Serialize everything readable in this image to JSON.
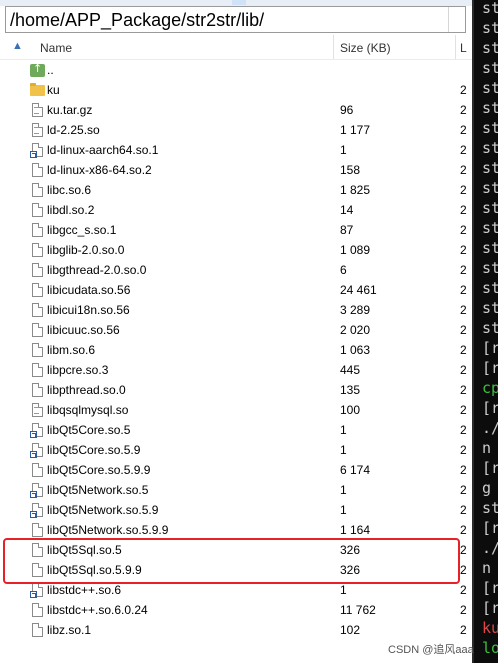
{
  "path_bar": {
    "value": "/home/APP_Package/str2str/lib/"
  },
  "columns": {
    "name": "Name",
    "size": "Size (KB)",
    "last": "L"
  },
  "files": [
    {
      "name": "..",
      "size": "",
      "extra": "",
      "icon": "parent-folder-icon"
    },
    {
      "name": "ku",
      "size": "",
      "extra": "2",
      "icon": "folder-icon"
    },
    {
      "name": "ku.tar.gz",
      "size": "96",
      "extra": "2",
      "icon": "archive-file-icon"
    },
    {
      "name": "ld-2.25.so",
      "size": "1 177",
      "extra": "2",
      "icon": "library-file-icon"
    },
    {
      "name": "ld-linux-aarch64.so.1",
      "size": "1",
      "extra": "2",
      "icon": "symlink-file-icon"
    },
    {
      "name": "ld-linux-x86-64.so.2",
      "size": "158",
      "extra": "2",
      "icon": "file-icon"
    },
    {
      "name": "libc.so.6",
      "size": "1 825",
      "extra": "2",
      "icon": "file-icon"
    },
    {
      "name": "libdl.so.2",
      "size": "14",
      "extra": "2",
      "icon": "file-icon"
    },
    {
      "name": "libgcc_s.so.1",
      "size": "87",
      "extra": "2",
      "icon": "file-icon"
    },
    {
      "name": "libglib-2.0.so.0",
      "size": "1 089",
      "extra": "2",
      "icon": "file-icon"
    },
    {
      "name": "libgthread-2.0.so.0",
      "size": "6",
      "extra": "2",
      "icon": "file-icon"
    },
    {
      "name": "libicudata.so.56",
      "size": "24 461",
      "extra": "2",
      "icon": "file-icon"
    },
    {
      "name": "libicui18n.so.56",
      "size": "3 289",
      "extra": "2",
      "icon": "file-icon"
    },
    {
      "name": "libicuuc.so.56",
      "size": "2 020",
      "extra": "2",
      "icon": "file-icon"
    },
    {
      "name": "libm.so.6",
      "size": "1 063",
      "extra": "2",
      "icon": "file-icon"
    },
    {
      "name": "libpcre.so.3",
      "size": "445",
      "extra": "2",
      "icon": "file-icon"
    },
    {
      "name": "libpthread.so.0",
      "size": "135",
      "extra": "2",
      "icon": "file-icon"
    },
    {
      "name": "libqsqlmysql.so",
      "size": "100",
      "extra": "2",
      "icon": "library-file-icon"
    },
    {
      "name": "libQt5Core.so.5",
      "size": "1",
      "extra": "2",
      "icon": "symlink-file-icon"
    },
    {
      "name": "libQt5Core.so.5.9",
      "size": "1",
      "extra": "2",
      "icon": "symlink-file-icon"
    },
    {
      "name": "libQt5Core.so.5.9.9",
      "size": "6 174",
      "extra": "2",
      "icon": "file-icon"
    },
    {
      "name": "libQt5Network.so.5",
      "size": "1",
      "extra": "2",
      "icon": "symlink-file-icon"
    },
    {
      "name": "libQt5Network.so.5.9",
      "size": "1",
      "extra": "2",
      "icon": "symlink-file-icon"
    },
    {
      "name": "libQt5Network.so.5.9.9",
      "size": "1 164",
      "extra": "2",
      "icon": "file-icon"
    },
    {
      "name": "libQt5Sql.so.5",
      "size": "326",
      "extra": "2",
      "icon": "file-icon"
    },
    {
      "name": "libQt5Sql.so.5.9.9",
      "size": "326",
      "extra": "2",
      "icon": "file-icon"
    },
    {
      "name": "libstdc++.so.6",
      "size": "1",
      "extra": "2",
      "icon": "symlink-file-icon"
    },
    {
      "name": "libstdc++.so.6.0.24",
      "size": "11 762",
      "extra": "2",
      "icon": "file-icon"
    },
    {
      "name": "libz.so.1",
      "size": "102",
      "extra": "2",
      "icon": "file-icon"
    }
  ],
  "terminal": {
    "lines": [
      {
        "text": "st",
        "color": "#cccccc"
      },
      {
        "text": "st",
        "color": "#cccccc"
      },
      {
        "text": "st",
        "color": "#cccccc"
      },
      {
        "text": "st",
        "color": "#cccccc"
      },
      {
        "text": "st",
        "color": "#cccccc"
      },
      {
        "text": "st",
        "color": "#cccccc"
      },
      {
        "text": "st",
        "color": "#cccccc"
      },
      {
        "text": "st",
        "color": "#cccccc"
      },
      {
        "text": "st",
        "color": "#cccccc"
      },
      {
        "text": "st",
        "color": "#cccccc"
      },
      {
        "text": "st",
        "color": "#cccccc"
      },
      {
        "text": "st",
        "color": "#cccccc"
      },
      {
        "text": "st",
        "color": "#cccccc"
      },
      {
        "text": "st",
        "color": "#cccccc"
      },
      {
        "text": "st",
        "color": "#cccccc"
      },
      {
        "text": "st",
        "color": "#cccccc"
      },
      {
        "text": "st",
        "color": "#cccccc"
      },
      {
        "text": "[r",
        "color": "#cccccc"
      },
      {
        "text": "[r",
        "color": "#cccccc"
      },
      {
        "text": "cp",
        "color": "#3bc13b"
      },
      {
        "text": "[r",
        "color": "#cccccc"
      },
      {
        "text": "./",
        "color": "#cccccc"
      },
      {
        "text": "n",
        "color": "#cccccc"
      },
      {
        "text": "[r",
        "color": "#cccccc"
      },
      {
        "text": "g",
        "color": "#cccccc"
      },
      {
        "text": "st",
        "color": "#cccccc"
      },
      {
        "text": "[r",
        "color": "#cccccc"
      },
      {
        "text": "./",
        "color": "#cccccc"
      },
      {
        "text": "n",
        "color": "#cccccc"
      },
      {
        "text": "[r",
        "color": "#cccccc"
      },
      {
        "text": "[r",
        "color": "#cccccc"
      },
      {
        "text": "ku",
        "color": "#e04848"
      },
      {
        "text": "lo",
        "color": "#3bc13b"
      }
    ]
  },
  "watermark": {
    "text": "CSDN @追风aaa"
  },
  "colors": {
    "highlight": "#e8202a",
    "terminal_bg": "#0c0c0c"
  }
}
